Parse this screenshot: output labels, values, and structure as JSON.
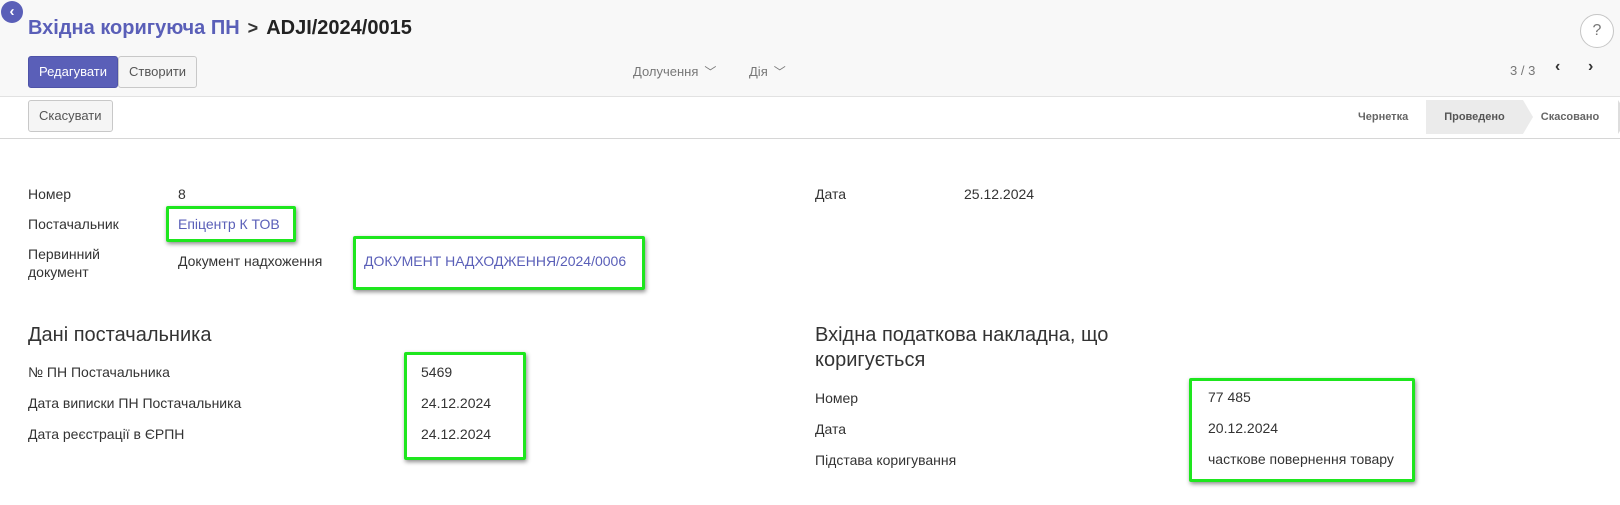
{
  "header": {
    "breadcrumb_parent": "Вхідна коригуюча ПН",
    "breadcrumb_separator": ">",
    "record_name": "ADJI/2024/0015",
    "help_label": "?"
  },
  "toolbar": {
    "edit_label": "Редагувати",
    "create_label": "Створити",
    "attachments_label": "Долучення",
    "action_label": "Дія",
    "pager": "3 / 3"
  },
  "statusbar": {
    "cancel_label": "Скасувати",
    "steps": [
      "Чернетка",
      "Проведено",
      "Скасовано"
    ],
    "active_step": "Проведено"
  },
  "form": {
    "number_label": "Номер",
    "number_value": "8",
    "supplier_label": "Постачальник",
    "supplier_value": "Епіцентр К ТОВ",
    "source_doc_label": "Первинний документ",
    "source_doc_type": "Документ надхоження",
    "source_doc_value": "ДОКУМЕНТ НАДХОДЖЕННЯ/2024/0006",
    "date_label": "Дата",
    "date_value": "25.12.2024"
  },
  "supplier_section": {
    "title": "Дані постачальника",
    "invoice_no_label": "№ ПН Постачальника",
    "invoice_no_value": "5469",
    "issue_date_label": "Дата виписки ПН Постачальника",
    "issue_date_value": "24.12.2024",
    "reg_date_label": "Дата реєстрації в ЄРПН",
    "reg_date_value": "24.12.2024"
  },
  "corrected_section": {
    "title": "Вхідна податкова накладна, що коригується",
    "number_label": "Номер",
    "number_value": "77 485",
    "date_label": "Дата",
    "date_value": "20.12.2024",
    "reason_label": "Підстава коригування",
    "reason_value": "часткове повернення товару"
  },
  "colors": {
    "accent": "#5a5fb8",
    "highlight": "#1ee61e"
  }
}
